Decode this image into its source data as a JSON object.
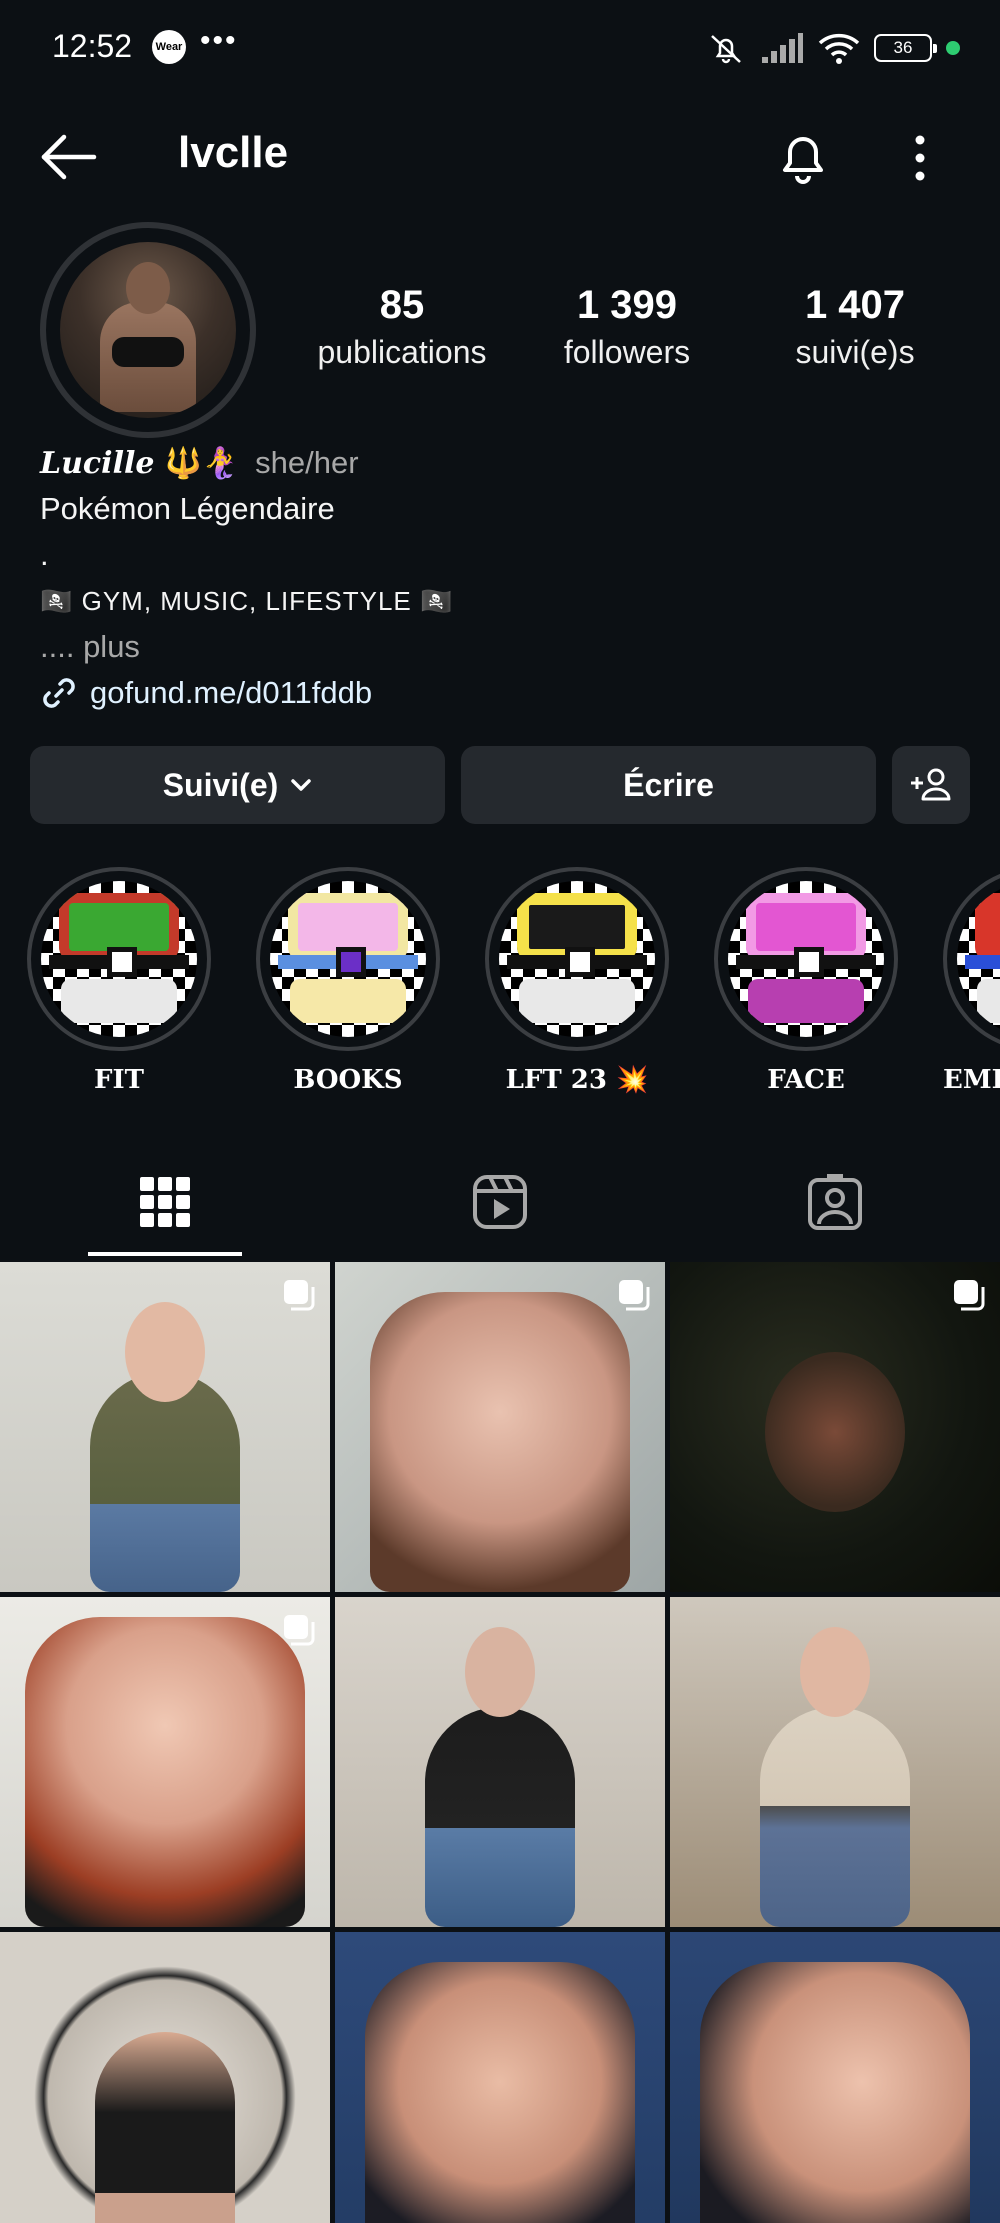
{
  "status_bar": {
    "time": "12:52",
    "wear_badge": "Wear",
    "more": "•••",
    "battery": "36",
    "icons": [
      "mute-icon",
      "signal-icon",
      "wifi-icon",
      "battery-icon",
      "dot-icon"
    ]
  },
  "header": {
    "username": "lvclle",
    "icons": [
      "back-arrow-icon",
      "bell-icon",
      "more-vert-icon"
    ]
  },
  "stats": {
    "posts_count": "85",
    "posts_label": "publications",
    "followers_count": "1 399",
    "followers_label": "followers",
    "following_count": "1 407",
    "following_label": "suivi(e)s"
  },
  "bio": {
    "name": "Lucille",
    "name_emojis": "🔱🧜‍♀️",
    "pronouns": "she/her",
    "line1": "Pokémon Légendaire",
    "line2": ".",
    "line3": "🏴‍☠️ GYM, MUSIC, LIFESTYLE 🏴‍☠️",
    "more": ".... plus",
    "link": "gofund.me/d011fddb"
  },
  "actions": {
    "follow_label": "Suivi(e)",
    "message_label": "Écrire"
  },
  "highlights": [
    {
      "label": "FIT",
      "color": "#3aa832"
    },
    {
      "label": "BOOKS",
      "color": "#f3b7e8"
    },
    {
      "label": "LFT 23 💥",
      "color": "#f5e14a"
    },
    {
      "label": "FACE",
      "color": "#e356d2"
    },
    {
      "label": "EMF",
      "color": "#d8362a"
    }
  ],
  "tabs": [
    "grid-icon",
    "reels-icon",
    "tagged-icon"
  ],
  "colors": {
    "background": "#0c1014",
    "button": "#25292e",
    "link": "#e0f1ff",
    "status_dot": "#2ecc71"
  }
}
